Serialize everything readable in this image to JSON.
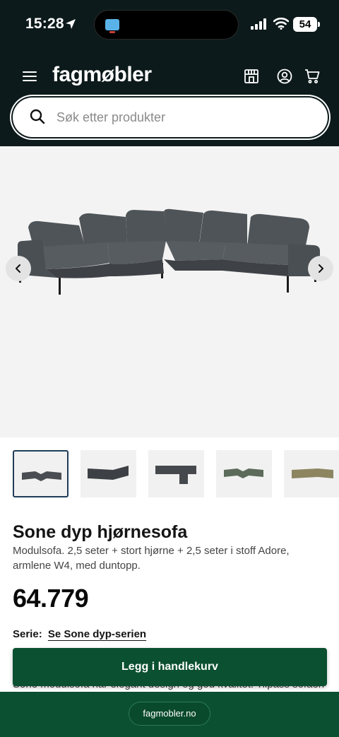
{
  "status_bar": {
    "time": "15:28",
    "battery": "54"
  },
  "header": {
    "logo": "fagmøbler",
    "search_placeholder": "Søk etter produkter"
  },
  "gallery": {
    "thumbnail_colors": [
      "#4a4e52",
      "#3d4145",
      "#45494d",
      "#5c6b5a",
      "#8c8560"
    ]
  },
  "product": {
    "title": "Sone dyp hjørnesofa",
    "description": "Modulsofa. 2,5 seter + stort hjørne + 2,5 seter i stoff Adore, armlene W4, med duntopp.",
    "price": "64.779",
    "series_label": "Serie:",
    "series_link": "Se Sone dyp-serien",
    "body_text": "Sone modulsofa har elegant design og god kvalitet. Tilpass sofaen"
  },
  "actions": {
    "add_to_cart": "Legg i handlekurv"
  },
  "browser": {
    "url": "fagmobler.no"
  },
  "colors": {
    "header_bg": "#0d1a1b",
    "brand_green": "#0b5030"
  }
}
